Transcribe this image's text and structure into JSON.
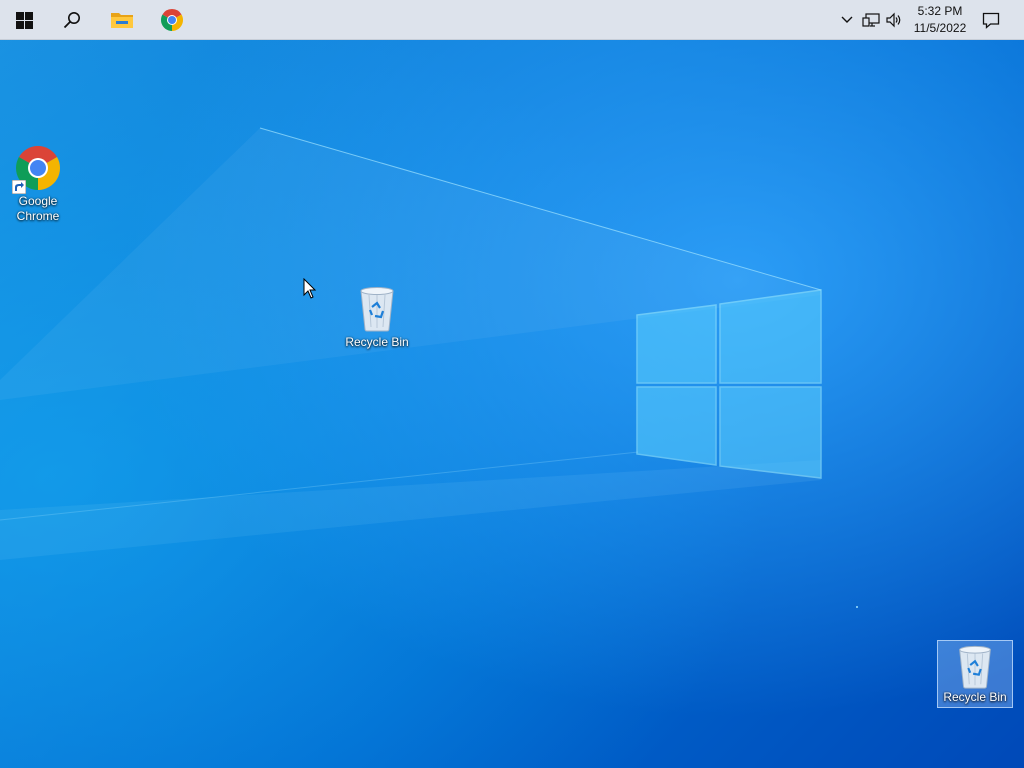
{
  "taskbar": {
    "start_icon": "windows-logo-icon",
    "search_icon": "search-icon",
    "pinned": [
      {
        "name": "file-explorer",
        "icon": "folder-icon"
      },
      {
        "name": "google-chrome",
        "icon": "chrome-icon"
      }
    ],
    "tray": {
      "overflow_icon": "chevron-up-icon",
      "network_icon": "network-icon",
      "volume_icon": "volume-icon",
      "time": "5:32 PM",
      "date": "11/5/2022",
      "notifications_icon": "notification-icon"
    }
  },
  "desktop": {
    "icons": [
      {
        "label": "Google\nChrome",
        "icon": "chrome-icon",
        "shortcut": true
      },
      {
        "label": "Recycle Bin",
        "icon": "recycle-bin-icon"
      },
      {
        "label": "Recycle Bin",
        "icon": "recycle-bin-icon",
        "selected": true
      }
    ]
  },
  "colors": {
    "taskbar_bg": "#dde3ec",
    "desktop_blue": "#0a7ad8",
    "chrome_red": "#db4437",
    "chrome_yellow": "#f4b400",
    "chrome_green": "#0f9d58",
    "chrome_blue": "#4285f4"
  }
}
